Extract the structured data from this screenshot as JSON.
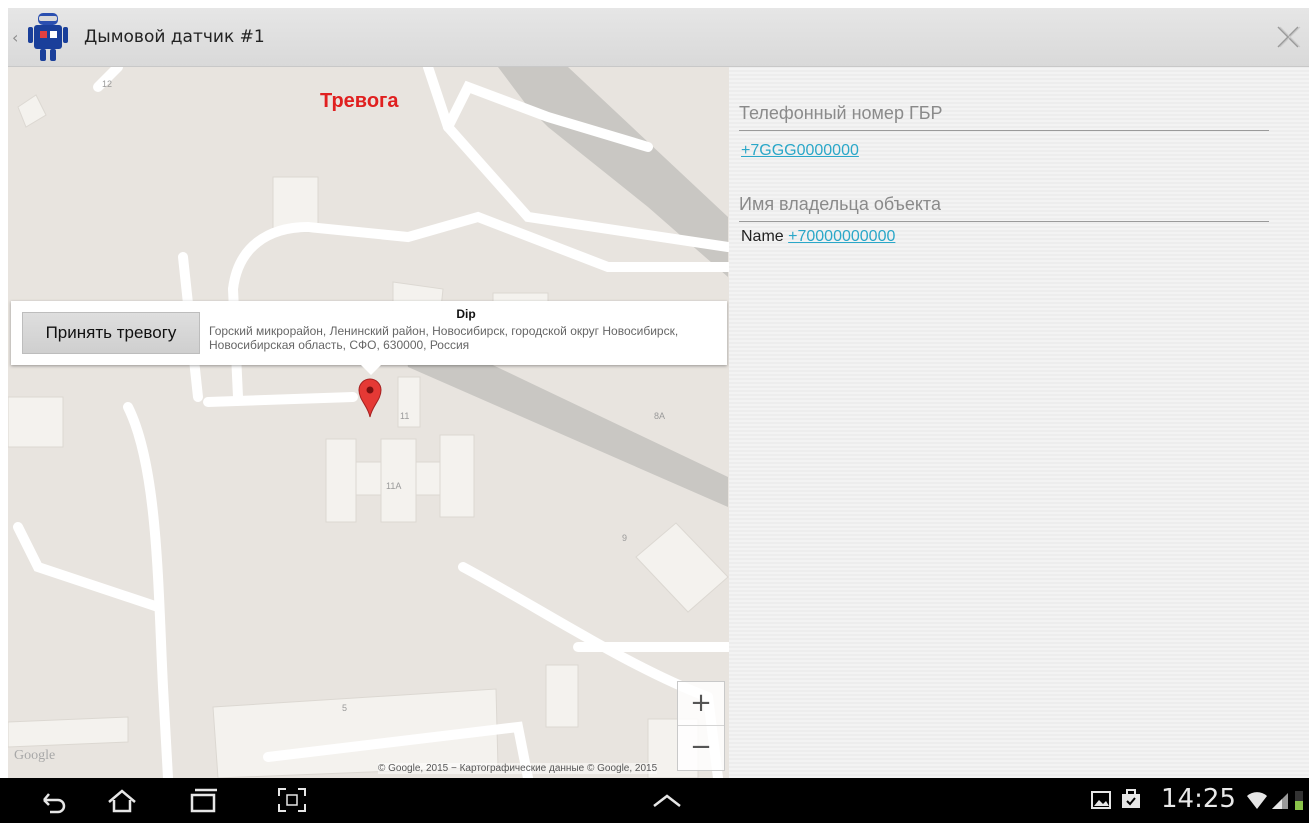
{
  "app": {
    "title": "Дымовой датчик #1",
    "icon": "robot-app-icon"
  },
  "map": {
    "status_label": "Тревога",
    "status_color": "#e02020",
    "marker": {
      "title": "Dip",
      "address": "Горский микрорайон, Ленинский район, Новосибирск, городской округ Новосибирск, Новосибирская область, СФО, 630000, Россия",
      "accept_button_label": "Принять тревогу"
    },
    "building_labels": [
      "12",
      "11",
      "11A",
      "8A",
      "9",
      "5"
    ],
    "zoom_in_label": "+",
    "zoom_out_label": "−",
    "logo": "Google",
    "copyright": "© Google, 2015 − Картографические данные © Google, 2015"
  },
  "details": {
    "phone_header": "Телефонный номер ГБР",
    "phone_value": "+7GGG0000000",
    "owner_header": "Имя владельца объекта",
    "owner_name": "Name",
    "owner_phone": "+70000000000"
  },
  "system_bar": {
    "time": "14:25",
    "buttons": [
      "back-icon",
      "home-icon",
      "recent-apps-icon",
      "screenshot-icon",
      "chevron-up-icon"
    ],
    "status_icons": [
      "gallery-icon",
      "briefcase-icon",
      "wifi-icon",
      "signal-icon",
      "battery-icon"
    ]
  },
  "colors": {
    "accent_link": "#2aa7c8",
    "alarm": "#e02020",
    "map_bg": "#e8e4df"
  }
}
